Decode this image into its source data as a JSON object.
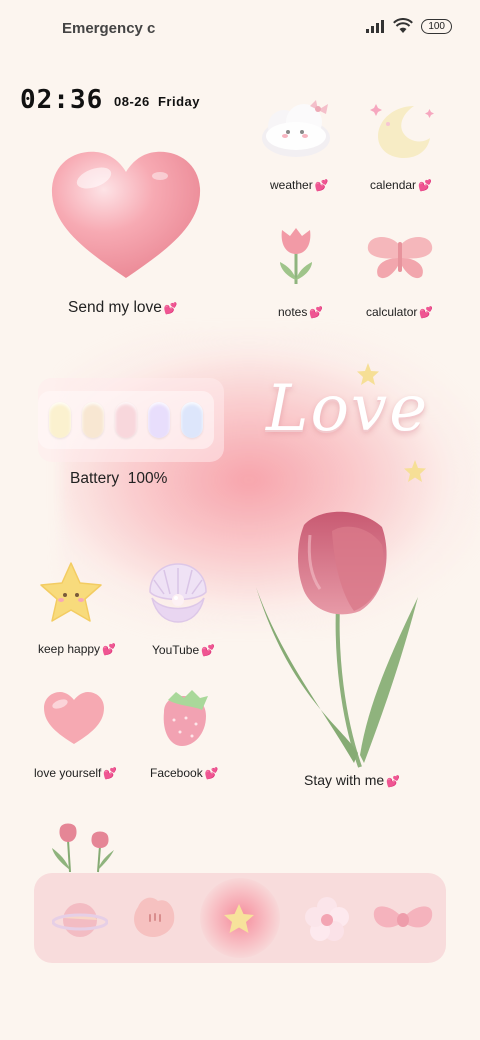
{
  "status_bar": {
    "carrier_text": "Emergency c",
    "battery_level": "100"
  },
  "clock": {
    "time": "02:36",
    "date": "08-26",
    "weekday": "Friday"
  },
  "widgets": {
    "send_love": "Send my love",
    "battery": {
      "label": "Battery  100%",
      "cell_colors": [
        "#fbf1cf",
        "#f8e7d2",
        "#f8d7dc",
        "#e8defc",
        "#dde6fb"
      ]
    },
    "love_text": "Love",
    "stay": "Stay with me"
  },
  "apps": {
    "weather": "weather",
    "calendar": "calendar",
    "notes": "notes",
    "calculator": "calculator",
    "keep_happy": "keep happy",
    "youtube": "YouTube",
    "love_yourself": "love yourself",
    "facebook": "Facebook"
  },
  "dock": {
    "icons": [
      "planet-icon",
      "paw-icon",
      "star-icon",
      "flower-icon",
      "bow-icon"
    ]
  },
  "colors": {
    "background": "#fcf5ef",
    "accent_pink": "#ec5aa6",
    "dock_bg": "#f8dcdc",
    "glow_pink": "#f696a0"
  }
}
